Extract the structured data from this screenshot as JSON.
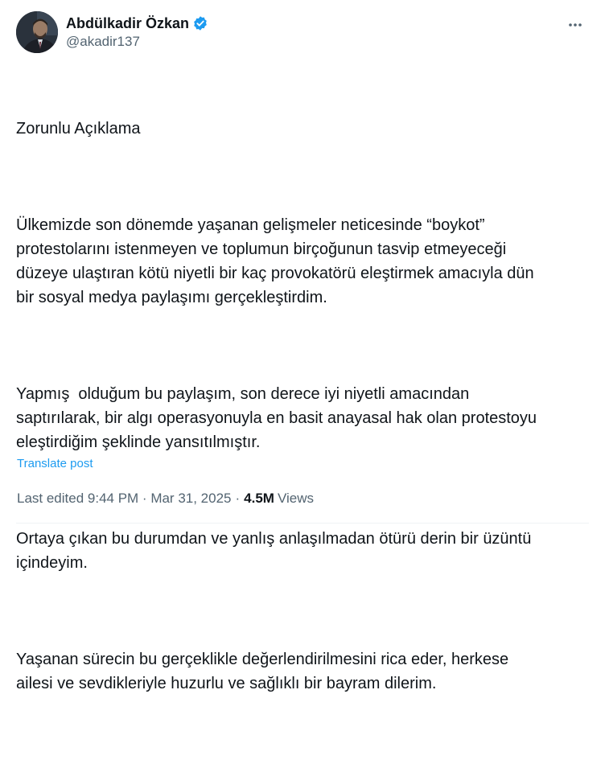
{
  "author": {
    "display_name": "Abdülkadir Özkan",
    "handle": "@akadir137",
    "verified": true,
    "verified_color": "#1d9bf0",
    "avatar_icon": "profile-photo"
  },
  "tweet": {
    "paragraphs": [
      "Zorunlu Açıklama",
      "Ülkemizde son dönemde yaşanan gelişmeler neticesinde “boykot”\nprotestolarını istenmeyen ve toplumun birçoğunun tasvip etmeyeceği\ndüzeye ulaştıran kötü niyetli bir kaç provokatörü eleştirmek amacıyla dün\nbir sosyal medya paylaşımı gerçekleştirdim.",
      "Yapmış  olduğum bu paylaşım, son derece iyi niyetli amacından\nsaptırılarak, bir algı operasyonuyla en basit anayasal hak olan protestoyu\neleştirdiğim şeklinde yansıtılmıştır.",
      "Ortaya çıkan bu durumdan ve yanlış anlaşılmadan ötürü derin bir üzüntü\niçindeyim.",
      "Yaşanan sürecin bu gerçeklikle değerlendirilmesini rica eder, herkese\nailesi ve sevdikleriyle huzurlu ve sağlıklı bir bayram dilerim."
    ],
    "translate_label": "Translate post"
  },
  "meta": {
    "edited_label": "Last edited 9:44 PM · Mar 31, 2025",
    "separator": "·",
    "views_count": "4.5M",
    "views_label": "Views"
  },
  "colors": {
    "text": "#0f1419",
    "secondary": "#536471",
    "link": "#1d9bf0"
  },
  "icons": {
    "more": "more-options-icon",
    "verified": "verified-badge-icon"
  }
}
